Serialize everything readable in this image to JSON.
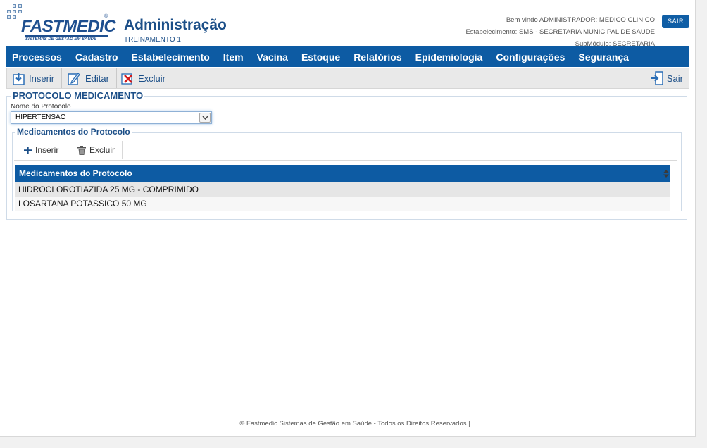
{
  "brand": {
    "logo_text": "FASTMEDIC",
    "logo_tagline": "SISTEMAS DE GESTÃO EM SAÚDE",
    "logo_reg": "®"
  },
  "header": {
    "title": "Administração",
    "subtitle": "TREINAMENTO 1",
    "welcome": "Bem vindo ADMINISTRADOR: MEDICO CLINICO",
    "establishment": "Estabelecimento: SMS - SECRETARIA MUNICIPAL DE SAUDE",
    "submodule": "SubMódulo: SECRETARIA",
    "logout_label": "SAIR"
  },
  "menu": {
    "items": [
      "Processos",
      "Cadastro",
      "Estabelecimento",
      "Item",
      "Vacina",
      "Estoque",
      "Relatórios",
      "Epidemiologia",
      "Configurações",
      "Segurança"
    ]
  },
  "toolbar": {
    "insert_label": "Inserir",
    "edit_label": "Editar",
    "delete_label": "Excluir",
    "exit_label": "Sair"
  },
  "form": {
    "legend": "PROTOCOLO MEDICAMENTO",
    "protocol_label": "Nome do Protocolo",
    "protocol_value": "HIPERTENSAO"
  },
  "medications": {
    "legend": "Medicamentos do Protocolo",
    "insert_label": "Inserir",
    "delete_label": "Excluir",
    "grid_header": "Medicamentos do Protocolo",
    "rows": [
      "HIDROCLOROTIAZIDA 25 MG - COMPRIMIDO",
      "LOSARTANA POTASSICO 50 MG"
    ]
  },
  "footer": {
    "text": "© Fastmedic Sistemas de Gestão em Saúde - Todos os Direitos Reservados |"
  },
  "colors": {
    "primary": "#0d5ba3",
    "title": "#1c4f88",
    "delete_red": "#d21a1a"
  },
  "icons": [
    "fastmedic-logo",
    "insert-icon",
    "edit-icon",
    "delete-icon",
    "exit-icon",
    "chevron-down-icon",
    "plus-icon",
    "trash-icon",
    "sort-icon"
  ]
}
